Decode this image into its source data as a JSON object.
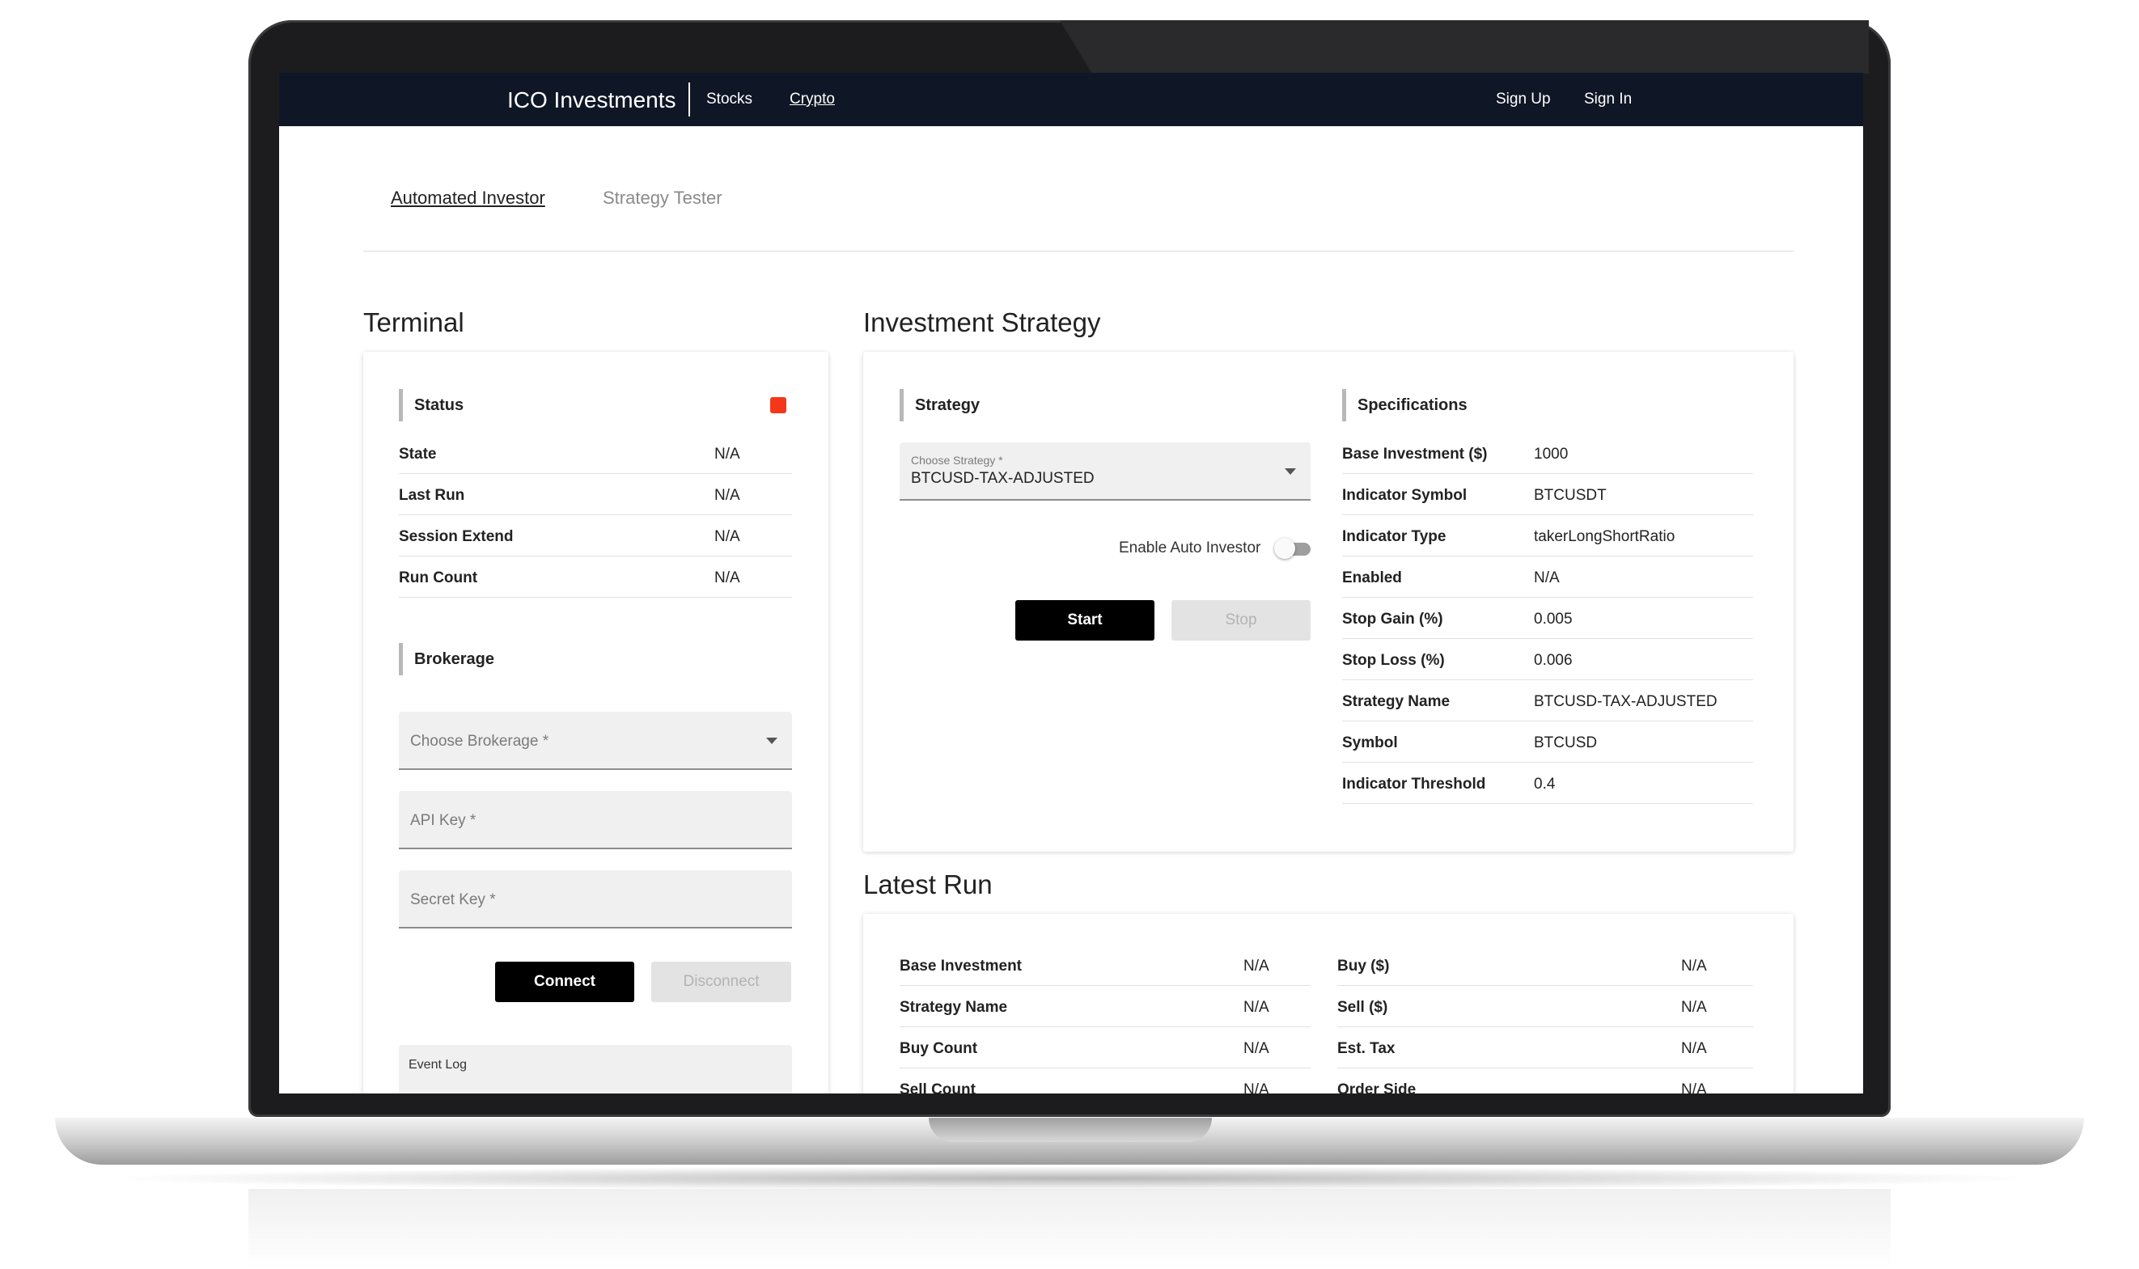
{
  "navbar": {
    "brand": "ICO Investments",
    "links": [
      {
        "label": "Stocks"
      },
      {
        "label": "Crypto"
      }
    ],
    "sign_up": "Sign Up",
    "sign_in": "Sign In"
  },
  "tabs": [
    {
      "label": "Automated Investor",
      "active": true
    },
    {
      "label": "Strategy Tester",
      "active": false
    }
  ],
  "terminal": {
    "title": "Terminal",
    "status": {
      "heading": "Status",
      "indicator_color": "#f4371b",
      "rows": [
        {
          "key": "State",
          "value": "N/A"
        },
        {
          "key": "Last Run",
          "value": "N/A"
        },
        {
          "key": "Session Extend",
          "value": "N/A"
        },
        {
          "key": "Run Count",
          "value": "N/A"
        }
      ]
    },
    "brokerage": {
      "heading": "Brokerage",
      "choose_placeholder": "Choose Brokerage *",
      "api_key_placeholder": "API Key *",
      "secret_key_placeholder": "Secret Key *",
      "connect_label": "Connect",
      "disconnect_label": "Disconnect"
    },
    "event_log_label": "Event Log"
  },
  "investment_strategy": {
    "title": "Investment Strategy",
    "strategy_heading": "Strategy",
    "choose_label": "Choose Strategy *",
    "selected_strategy": "BTCUSD-TAX-ADJUSTED",
    "auto_investor_label": "Enable Auto Investor",
    "auto_investor_enabled": false,
    "start_label": "Start",
    "stop_label": "Stop",
    "specifications_heading": "Specifications",
    "specs": [
      {
        "key": "Base Investment ($)",
        "value": "1000"
      },
      {
        "key": "Indicator Symbol",
        "value": "BTCUSDT"
      },
      {
        "key": "Indicator Type",
        "value": "takerLongShortRatio"
      },
      {
        "key": "Enabled",
        "value": "N/A"
      },
      {
        "key": "Stop Gain (%)",
        "value": "0.005"
      },
      {
        "key": "Stop Loss (%)",
        "value": "0.006"
      },
      {
        "key": "Strategy Name",
        "value": "BTCUSD-TAX-ADJUSTED"
      },
      {
        "key": "Symbol",
        "value": "BTCUSD"
      },
      {
        "key": "Indicator Threshold",
        "value": "0.4"
      }
    ]
  },
  "latest_run": {
    "title": "Latest Run",
    "left": [
      {
        "key": "Base Investment",
        "value": "N/A"
      },
      {
        "key": "Strategy Name",
        "value": "N/A"
      },
      {
        "key": "Buy Count",
        "value": "N/A"
      },
      {
        "key": "Sell Count",
        "value": "N/A"
      }
    ],
    "right": [
      {
        "key": "Buy ($)",
        "value": "N/A"
      },
      {
        "key": "Sell ($)",
        "value": "N/A"
      },
      {
        "key": "Est. Tax",
        "value": "N/A"
      },
      {
        "key": "Order Side",
        "value": "N/A"
      }
    ]
  }
}
